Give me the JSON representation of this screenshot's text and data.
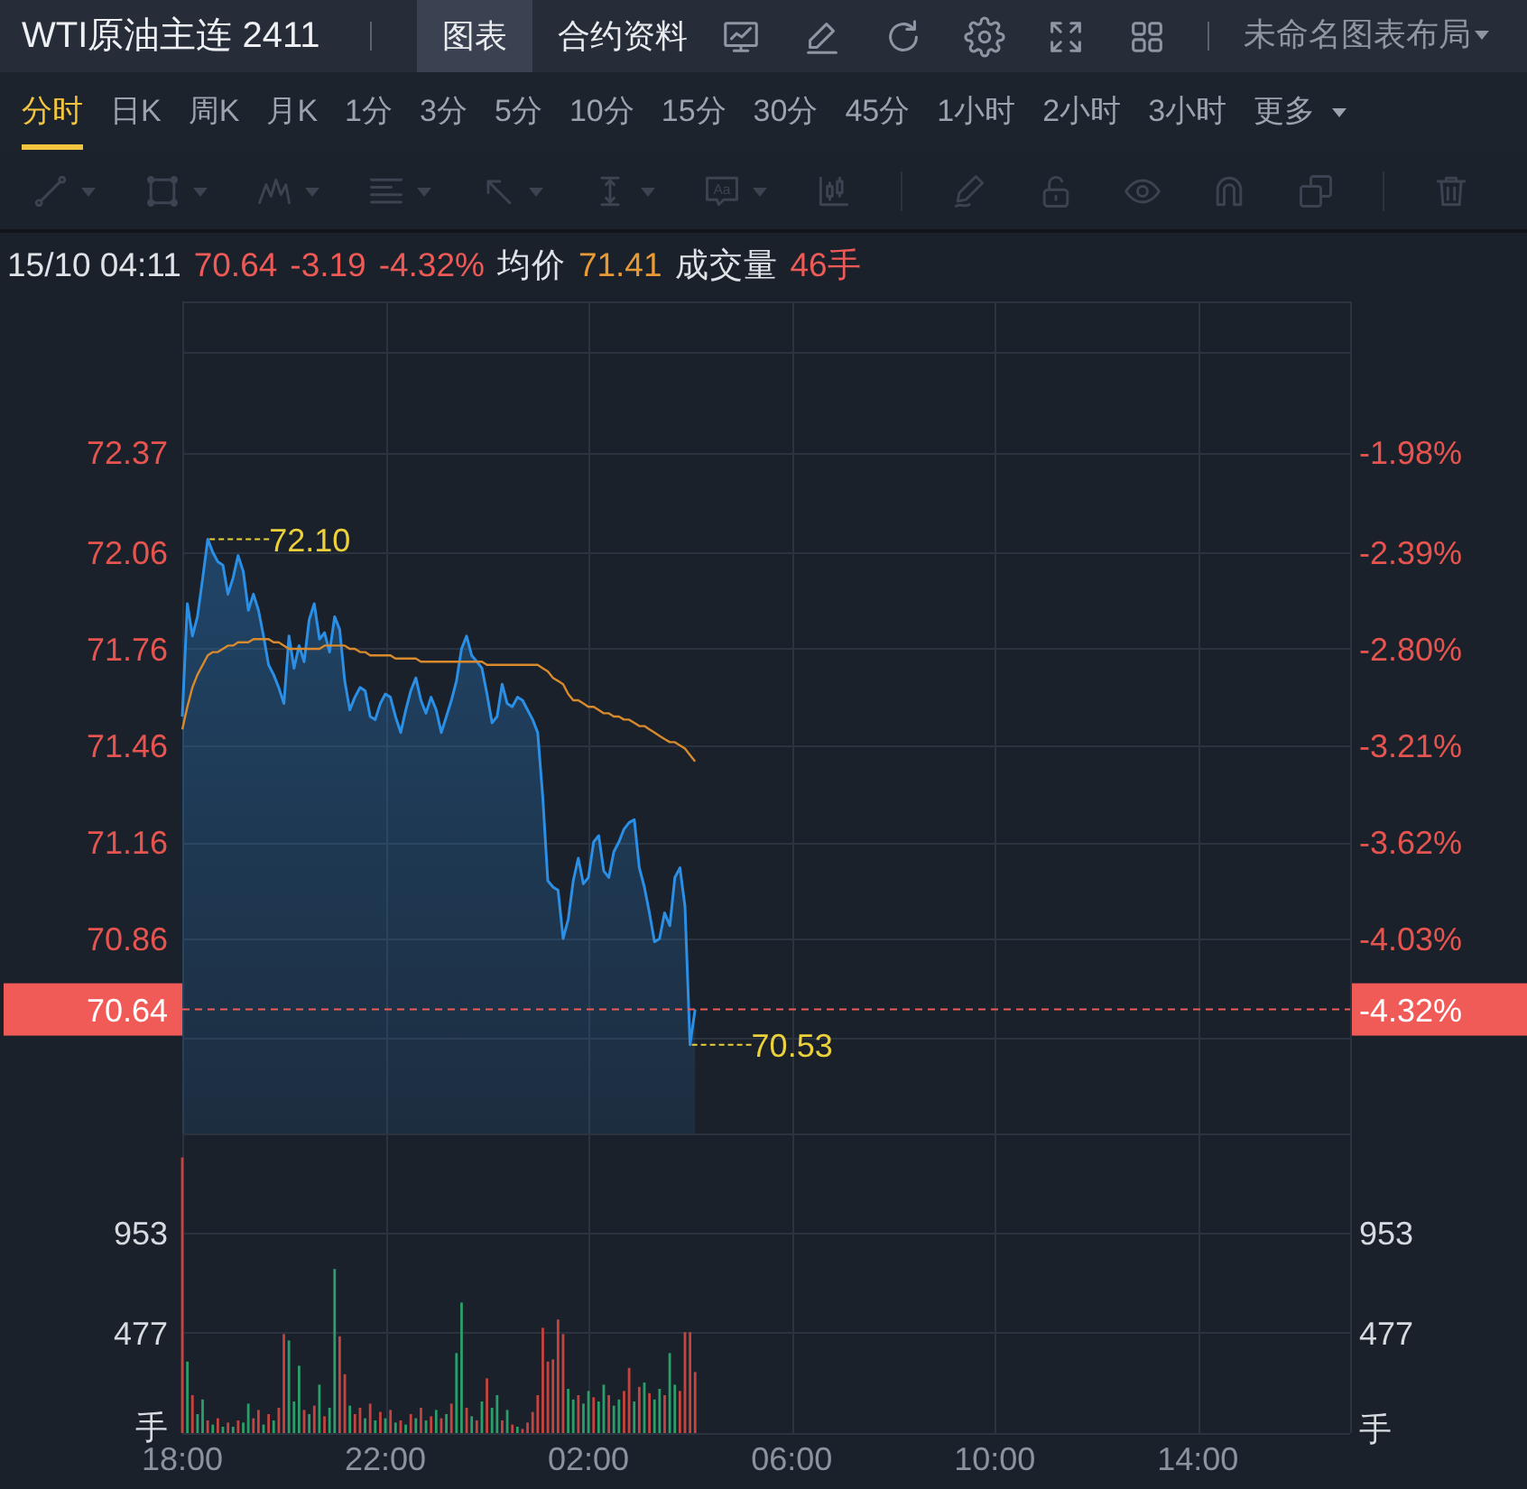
{
  "header": {
    "title": "WTI原油主连 2411",
    "tabs": [
      {
        "label": "图表",
        "selected": true
      },
      {
        "label": "合约资料",
        "selected": false
      }
    ],
    "tools": [
      {
        "kind": "chart"
      },
      {
        "kind": "edit"
      },
      {
        "kind": "refresh"
      },
      {
        "kind": "settings"
      },
      {
        "kind": "fullscreen"
      },
      {
        "kind": "layout"
      }
    ],
    "layout_name": "未命名图表布局"
  },
  "periods": [
    {
      "label": "分时",
      "kind": "period",
      "selected": true
    },
    {
      "label": "日K",
      "kind": "period",
      "selected": false
    },
    {
      "label": "周K",
      "kind": "period",
      "selected": false
    },
    {
      "label": "月K",
      "kind": "period",
      "selected": false
    },
    {
      "label": "1分",
      "kind": "period",
      "selected": false
    },
    {
      "label": "3分",
      "kind": "period",
      "selected": false
    },
    {
      "label": "5分",
      "kind": "period",
      "selected": false
    },
    {
      "label": "10分",
      "kind": "period",
      "selected": false
    },
    {
      "label": "15分",
      "kind": "period",
      "selected": false
    },
    {
      "label": "30分",
      "kind": "period",
      "selected": false
    },
    {
      "label": "45分",
      "kind": "period",
      "selected": false
    },
    {
      "label": "1小时",
      "kind": "period",
      "selected": false
    },
    {
      "label": "2小时",
      "kind": "period",
      "selected": false
    },
    {
      "label": "3小时",
      "kind": "period",
      "selected": false
    },
    {
      "label": "更多",
      "kind": "menu",
      "selected": false
    }
  ],
  "drawing_toolbar": [
    [
      {
        "kind": "line",
        "dropdown": true
      },
      {
        "kind": "rectangle",
        "dropdown": true
      },
      {
        "kind": "pattern",
        "dropdown": true
      },
      {
        "kind": "fibonacci",
        "dropdown": true
      },
      {
        "kind": "arrow",
        "dropdown": true
      },
      {
        "kind": "measure",
        "dropdown": true
      },
      {
        "kind": "text",
        "dropdown": true,
        "glyph": "Aa"
      },
      {
        "kind": "indicator",
        "dropdown": false
      }
    ],
    [
      {
        "kind": "brush",
        "dropdown": false
      },
      {
        "kind": "lock",
        "dropdown": false
      },
      {
        "kind": "visibility",
        "dropdown": false
      },
      {
        "kind": "magnet",
        "dropdown": false
      },
      {
        "kind": "copy",
        "dropdown": false
      }
    ],
    [
      {
        "kind": "delete",
        "dropdown": false
      }
    ]
  ],
  "quote": [
    {
      "text": "15/10 04:11",
      "color": "#dfe2e6"
    },
    {
      "text": "70.64",
      "color": "#ee5b57"
    },
    {
      "text": "-3.19",
      "color": "#ee5b57"
    },
    {
      "text": "-4.32%",
      "color": "#ee5b57"
    },
    {
      "text": "均价",
      "color": "#dfe2e6"
    },
    {
      "text": "71.41",
      "color": "#e89a35"
    },
    {
      "text": "成交量",
      "color": "#dfe2e6"
    },
    {
      "text": "46手",
      "color": "#ee5b57"
    }
  ],
  "price_panel": {
    "chart_data": {
      "type": "line",
      "grid": true,
      "categories": [
        null,
        null,
        null,
        null,
        null,
        null,
        null,
        null,
        null,
        null,
        null,
        null,
        null,
        null,
        null,
        null,
        null,
        null,
        null,
        null,
        null,
        null,
        null,
        null,
        null,
        null,
        null,
        null,
        null,
        null,
        null,
        null,
        null,
        null,
        null,
        null,
        null,
        null,
        null,
        null,
        null,
        null,
        null,
        null,
        null,
        null,
        null,
        null,
        null,
        null,
        null,
        null,
        null,
        null,
        null,
        null,
        null,
        null,
        null,
        null,
        null,
        null,
        null,
        null,
        null,
        null,
        null,
        null,
        null,
        null,
        null,
        null,
        null,
        null,
        null,
        null,
        null,
        null,
        null,
        null,
        null,
        null,
        null,
        null,
        null,
        null,
        null,
        null,
        null,
        null,
        null,
        null,
        null,
        null,
        null,
        null,
        null,
        null,
        null,
        null,
        null,
        null,
        null,
        null,
        null,
        null,
        null,
        null,
        null,
        null,
        null,
        null,
        null,
        null,
        null,
        null,
        null,
        null,
        null,
        null,
        null,
        null,
        null,
        null,
        null,
        null,
        null,
        null,
        null,
        null,
        null,
        null,
        null,
        null,
        null,
        null,
        null,
        null,
        null,
        null,
        null,
        null,
        null,
        null,
        null,
        null,
        null,
        null,
        null,
        null,
        null,
        null,
        null,
        null,
        null,
        null,
        null,
        null,
        null,
        null,
        null,
        null,
        null,
        null,
        null,
        null,
        null,
        null,
        null,
        null,
        null,
        null,
        null,
        null,
        null,
        null,
        null,
        null,
        null,
        null,
        null,
        null,
        null,
        null,
        null,
        null,
        null,
        null,
        null,
        null,
        null,
        null,
        null,
        null,
        null,
        null,
        null,
        null,
        null,
        null,
        null,
        null,
        null,
        null,
        null,
        null,
        null,
        null,
        null,
        null,
        null,
        null,
        null,
        null,
        null,
        null,
        null,
        null,
        null,
        null,
        null,
        null,
        null,
        null,
        null,
        null,
        null,
        null,
        null,
        null
      ],
      "series": [
        {
          "color": "#2b8fe6",
          "values": [
            71.55,
            71.9,
            71.8,
            71.86,
            71.98,
            72.1,
            72.06,
            72.03,
            72.02,
            71.93,
            71.98,
            72.05,
            72,
            71.88,
            71.93,
            71.88,
            71.8,
            71.71,
            71.68,
            71.64,
            71.59,
            71.8,
            71.7,
            71.77,
            71.72,
            71.85,
            71.9,
            71.79,
            71.81,
            71.75,
            71.86,
            71.82,
            71.66,
            71.57,
            71.61,
            71.64,
            71.63,
            71.55,
            71.54,
            71.59,
            71.62,
            71.61,
            71.55,
            71.5,
            71.57,
            71.63,
            71.67,
            71.6,
            71.56,
            71.61,
            71.57,
            71.5,
            71.55,
            71.6,
            71.66,
            71.76,
            71.8,
            71.74,
            71.72,
            71.7,
            71.62,
            71.53,
            71.55,
            71.65,
            71.59,
            71.58,
            71.61,
            71.6,
            71.57,
            71.54,
            71.5,
            71.3,
            71.04,
            71.02,
            71.01,
            70.86,
            70.92,
            71.04,
            71.11,
            71.03,
            71.05,
            71.16,
            71.18,
            71.07,
            71.05,
            71.13,
            71.16,
            71.2,
            71.22,
            71.23,
            71.08,
            71.02,
            70.94,
            70.85,
            70.86,
            70.94,
            70.9,
            71.05,
            71.08,
            70.96,
            70.53,
            70.64,
            null,
            null,
            null,
            null,
            null,
            null,
            null,
            null,
            null,
            null,
            null,
            null,
            null,
            null,
            null,
            null,
            null,
            null,
            null,
            null,
            null,
            null,
            null,
            null,
            null,
            null,
            null,
            null,
            null,
            null,
            null,
            null,
            null,
            null,
            null,
            null,
            null,
            null,
            null,
            null,
            null,
            null,
            null,
            null,
            null,
            null,
            null,
            null,
            null,
            null,
            null,
            null,
            null,
            null,
            null,
            null,
            null,
            null,
            null,
            null,
            null,
            null,
            null,
            null,
            null,
            null,
            null,
            null,
            null,
            null,
            null,
            null,
            null,
            null,
            null,
            null,
            null,
            null,
            null,
            null,
            null,
            null,
            null,
            null,
            null,
            null,
            null,
            null,
            null,
            null,
            null,
            null,
            null,
            null,
            null,
            null,
            null,
            null,
            null,
            null,
            null,
            null,
            null,
            null,
            null,
            null,
            null,
            null,
            null,
            null,
            null,
            null,
            null,
            null,
            null,
            null,
            null,
            null,
            null,
            null,
            null,
            null,
            null,
            null,
            null,
            null,
            null,
            null
          ]
        },
        {
          "color": "#d98a2c",
          "values": [
            71.51,
            71.58,
            71.64,
            71.68,
            71.71,
            71.74,
            71.75,
            71.75,
            71.76,
            71.77,
            71.77,
            71.78,
            71.78,
            71.78,
            71.79,
            71.79,
            71.79,
            71.79,
            71.78,
            71.78,
            71.77,
            71.76,
            71.76,
            71.76,
            71.76,
            71.76,
            71.76,
            71.76,
            71.77,
            71.77,
            71.77,
            71.77,
            71.77,
            71.76,
            71.76,
            71.75,
            71.75,
            71.74,
            71.74,
            71.74,
            71.74,
            71.74,
            71.73,
            71.73,
            71.73,
            71.73,
            71.73,
            71.72,
            71.72,
            71.72,
            71.72,
            71.72,
            71.72,
            71.72,
            71.72,
            71.72,
            71.72,
            71.72,
            71.72,
            71.72,
            71.71,
            71.71,
            71.71,
            71.71,
            71.71,
            71.71,
            71.71,
            71.71,
            71.71,
            71.71,
            71.71,
            71.7,
            71.69,
            71.67,
            71.66,
            71.65,
            71.62,
            71.6,
            71.6,
            71.59,
            71.58,
            71.58,
            71.57,
            71.56,
            71.56,
            71.55,
            71.55,
            71.54,
            71.54,
            71.53,
            71.52,
            71.52,
            71.51,
            71.5,
            71.49,
            71.48,
            71.47,
            71.47,
            71.46,
            71.45,
            71.43,
            71.41,
            null,
            null,
            null,
            null,
            null,
            null,
            null,
            null,
            null,
            null,
            null,
            null,
            null,
            null,
            null,
            null,
            null,
            null,
            null,
            null,
            null,
            null,
            null,
            null,
            null,
            null,
            null,
            null,
            null,
            null,
            null,
            null,
            null,
            null,
            null,
            null,
            null,
            null,
            null,
            null,
            null,
            null,
            null,
            null,
            null,
            null,
            null,
            null,
            null,
            null,
            null,
            null,
            null,
            null,
            null,
            null,
            null,
            null,
            null,
            null,
            null,
            null,
            null,
            null,
            null,
            null,
            null,
            null,
            null,
            null,
            null,
            null,
            null,
            null,
            null,
            null,
            null,
            null,
            null,
            null,
            null,
            null,
            null,
            null,
            null,
            null,
            null,
            null,
            null,
            null,
            null,
            null,
            null,
            null,
            null,
            null,
            null,
            null,
            null,
            null,
            null,
            null,
            null,
            null,
            null,
            null,
            null,
            null,
            null,
            null,
            null,
            null,
            null,
            null,
            null,
            null,
            null,
            null,
            null,
            null,
            null,
            null,
            null,
            null,
            null,
            null,
            null,
            null
          ]
        }
      ],
      "ylim": [
        70.255,
        72.839
      ],
      "yticks": [
        72.37,
        72.06,
        71.76,
        71.46,
        71.16,
        70.86
      ],
      "annotations": [
        "72.10",
        "70.53"
      ],
      "ref_lines": [
        {
          "axis": "y",
          "value": 70.64,
          "label": "70.64",
          "color": "#f05b57"
        }
      ]
    },
    "percent_labels": [
      "-1.98%",
      "-2.39%",
      "-2.80%",
      "-3.21%",
      "-3.62%",
      "-4.03%"
    ],
    "current_percent_label": "-4.32%"
  },
  "volume_panel": {
    "chart_data": {
      "type": "bar",
      "grid": true,
      "categories": [
        "18:00",
        null,
        null,
        null,
        null,
        null,
        null,
        null,
        null,
        null,
        null,
        null,
        null,
        null,
        null,
        null,
        null,
        null,
        null,
        null,
        null,
        null,
        null,
        null,
        null,
        null,
        null,
        null,
        null,
        null,
        null,
        null,
        null,
        null,
        null,
        null,
        null,
        null,
        null,
        null,
        "22:00",
        null,
        null,
        null,
        null,
        null,
        null,
        null,
        null,
        null,
        null,
        null,
        null,
        null,
        null,
        null,
        null,
        null,
        null,
        null,
        null,
        null,
        null,
        null,
        null,
        null,
        null,
        null,
        null,
        null,
        null,
        null,
        null,
        null,
        null,
        null,
        null,
        null,
        null,
        null,
        "02:00",
        null,
        null,
        null,
        null,
        null,
        null,
        null,
        null,
        null,
        null,
        null,
        null,
        null,
        null,
        null,
        null,
        null,
        null,
        null,
        null,
        null,
        null,
        null,
        null,
        null,
        null,
        null,
        null,
        null,
        null,
        null,
        null,
        null,
        null,
        null,
        null,
        null,
        null,
        null,
        "06:00",
        null,
        null,
        null,
        null,
        null,
        null,
        null,
        null,
        null,
        null,
        null,
        null,
        null,
        null,
        null,
        null,
        null,
        null,
        null,
        null,
        null,
        null,
        null,
        null,
        null,
        null,
        null,
        null,
        null,
        null,
        null,
        null,
        null,
        null,
        null,
        null,
        null,
        null,
        null,
        "10:00",
        null,
        null,
        null,
        null,
        null,
        null,
        null,
        null,
        null,
        null,
        null,
        null,
        null,
        null,
        null,
        null,
        null,
        null,
        null,
        null,
        null,
        null,
        null,
        null,
        null,
        null,
        null,
        null,
        null,
        null,
        null,
        null,
        null,
        null,
        null,
        null,
        null,
        null,
        null,
        "14:00",
        null,
        null,
        null,
        null,
        null,
        null,
        null,
        null,
        null,
        null,
        null,
        null,
        null,
        null,
        null,
        null,
        null,
        null,
        null,
        null,
        null,
        null,
        null,
        null,
        null,
        null,
        null,
        null,
        null
      ],
      "series": [
        {
          "color": "#c4443f",
          "values": [
            1310,
            null,
            180,
            null,
            null,
            60,
            null,
            70,
            null,
            50,
            null,
            60,
            null,
            null,
            70,
            110,
            null,
            90,
            null,
            120,
            470,
            null,
            null,
            null,
            110,
            null,
            130,
            null,
            80,
            null,
            null,
            460,
            280,
            null,
            90,
            120,
            null,
            140,
            null,
            100,
            null,
            110,
            null,
            60,
            null,
            90,
            null,
            120,
            null,
            80,
            null,
            70,
            null,
            140,
            null,
            null,
            120,
            null,
            60,
            null,
            260,
            null,
            null,
            60,
            null,
            40,
            null,
            20,
            50,
            100,
            180,
            500,
            340,
            350,
            540,
            470,
            null,
            null,
            180,
            null,
            null,
            170,
            null,
            null,
            180,
            null,
            null,
            200,
            310,
            null,
            220,
            null,
            190,
            null,
            null,
            180,
            null,
            null,
            200,
            480,
            480,
            290,
            null,
            null,
            null,
            null,
            null,
            null,
            null,
            null,
            null,
            null,
            null,
            null,
            null,
            null,
            null,
            null,
            null,
            null,
            null,
            null,
            null,
            null,
            null,
            null,
            null,
            null,
            null,
            null,
            null,
            null,
            null,
            null,
            null,
            null,
            null,
            null,
            null,
            null,
            null,
            null,
            null,
            null,
            null,
            null,
            null,
            null,
            null,
            null,
            null,
            null,
            null,
            null,
            null,
            null,
            null,
            null,
            null,
            null,
            null,
            null,
            null,
            null,
            null,
            null,
            null,
            null,
            null,
            null,
            null,
            null,
            null,
            null,
            null,
            null,
            null,
            null,
            null,
            null,
            null,
            null,
            null,
            null,
            null,
            null,
            null,
            null,
            null,
            null,
            null,
            null,
            null,
            null,
            null,
            null,
            null,
            null,
            null,
            null,
            null,
            null,
            null,
            null,
            null,
            null,
            null,
            null,
            null,
            null,
            null,
            null,
            null,
            null,
            null,
            null,
            null,
            null,
            null,
            null,
            null,
            null,
            null,
            null,
            null,
            null,
            null,
            null,
            null,
            null
          ]
        },
        {
          "color": "#2a9f69",
          "values": [
            null,
            340,
            null,
            90,
            160,
            null,
            40,
            null,
            30,
            null,
            30,
            null,
            50,
            140,
            null,
            null,
            40,
            null,
            60,
            null,
            null,
            440,
            150,
            320,
            null,
            90,
            null,
            230,
            null,
            120,
            780,
            null,
            null,
            130,
            null,
            null,
            70,
            null,
            60,
            null,
            70,
            null,
            50,
            null,
            40,
            null,
            70,
            null,
            60,
            null,
            110,
            null,
            90,
            null,
            380,
            620,
            null,
            80,
            null,
            150,
            null,
            120,
            180,
            null,
            110,
            null,
            30,
            null,
            null,
            null,
            null,
            null,
            null,
            null,
            null,
            null,
            210,
            160,
            null,
            140,
            200,
            null,
            150,
            230,
            null,
            130,
            160,
            null,
            null,
            150,
            null,
            240,
            null,
            160,
            210,
            null,
            380,
            230,
            null,
            null,
            null,
            null,
            null,
            null,
            null,
            null,
            null,
            null,
            null,
            null,
            null,
            null,
            null,
            null,
            null,
            null,
            null,
            null,
            null,
            null,
            null,
            null,
            null,
            null,
            null,
            null,
            null,
            null,
            null,
            null,
            null,
            null,
            null,
            null,
            null,
            null,
            null,
            null,
            null,
            null,
            null,
            null,
            null,
            null,
            null,
            null,
            null,
            null,
            null,
            null,
            null,
            null,
            null,
            null,
            null,
            null,
            null,
            null,
            null,
            null,
            null,
            null,
            null,
            null,
            null,
            null,
            null,
            null,
            null,
            null,
            null,
            null,
            null,
            null,
            null,
            null,
            null,
            null,
            null,
            null,
            null,
            null,
            null,
            null,
            null,
            null,
            null,
            null,
            null,
            null,
            null,
            null,
            null,
            null,
            null,
            null,
            null,
            null,
            null,
            null,
            null,
            null,
            null,
            null,
            null,
            null,
            null,
            null,
            null,
            null,
            null,
            null,
            null,
            null,
            null,
            null,
            null,
            null,
            null,
            null,
            null,
            null,
            null,
            null,
            null,
            null,
            null,
            null,
            null,
            null
          ]
        }
      ],
      "ylim": [
        0,
        1420
      ],
      "yticks": [
        {
          "value": 953,
          "label": "953"
        },
        {
          "value": 477,
          "label": "477"
        }
      ]
    },
    "right_labels": [
      "953",
      "477"
    ],
    "unit_left": "手",
    "unit_right": "手"
  }
}
